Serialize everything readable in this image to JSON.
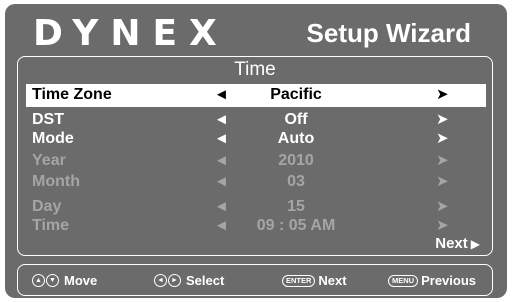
{
  "header": {
    "brand": "DYNEX",
    "title": "Setup Wizard"
  },
  "panel": {
    "heading": "Time",
    "rows": [
      {
        "label": "Time Zone",
        "value": "Pacific",
        "left_arrow": "◄",
        "right_arrow": "➤"
      },
      {
        "label": "DST",
        "value": "Off",
        "left_arrow": "◄",
        "right_arrow": "➤"
      },
      {
        "label": "Mode",
        "value": "Auto",
        "left_arrow": "◄",
        "right_arrow": "➤"
      },
      {
        "label": "Year",
        "value": "2010",
        "left_arrow": "◄",
        "right_arrow": "➤"
      },
      {
        "label": "Month",
        "value": "03",
        "left_arrow": "◄",
        "right_arrow": "➤"
      },
      {
        "label": "Day",
        "value": "15",
        "left_arrow": "◄",
        "right_arrow": "➤"
      },
      {
        "label": "Time",
        "value": "09 : 05  AM",
        "left_arrow": "◄",
        "right_arrow": "➤"
      }
    ],
    "next": "Next",
    "next_glyph": "▶"
  },
  "footer": {
    "move": {
      "icons": [
        "▲",
        "▼"
      ],
      "label": "Move"
    },
    "select": {
      "icons": [
        "◄",
        "►"
      ],
      "label": "Select"
    },
    "next": {
      "key": "ENTER",
      "label": "Next"
    },
    "previous": {
      "key": "MENU",
      "label": "Previous"
    }
  },
  "colors": {
    "background": "#6b6b6b",
    "selected_row": "#ffffff",
    "disabled_text": "#a5a5a5",
    "text": "#ffffff"
  }
}
